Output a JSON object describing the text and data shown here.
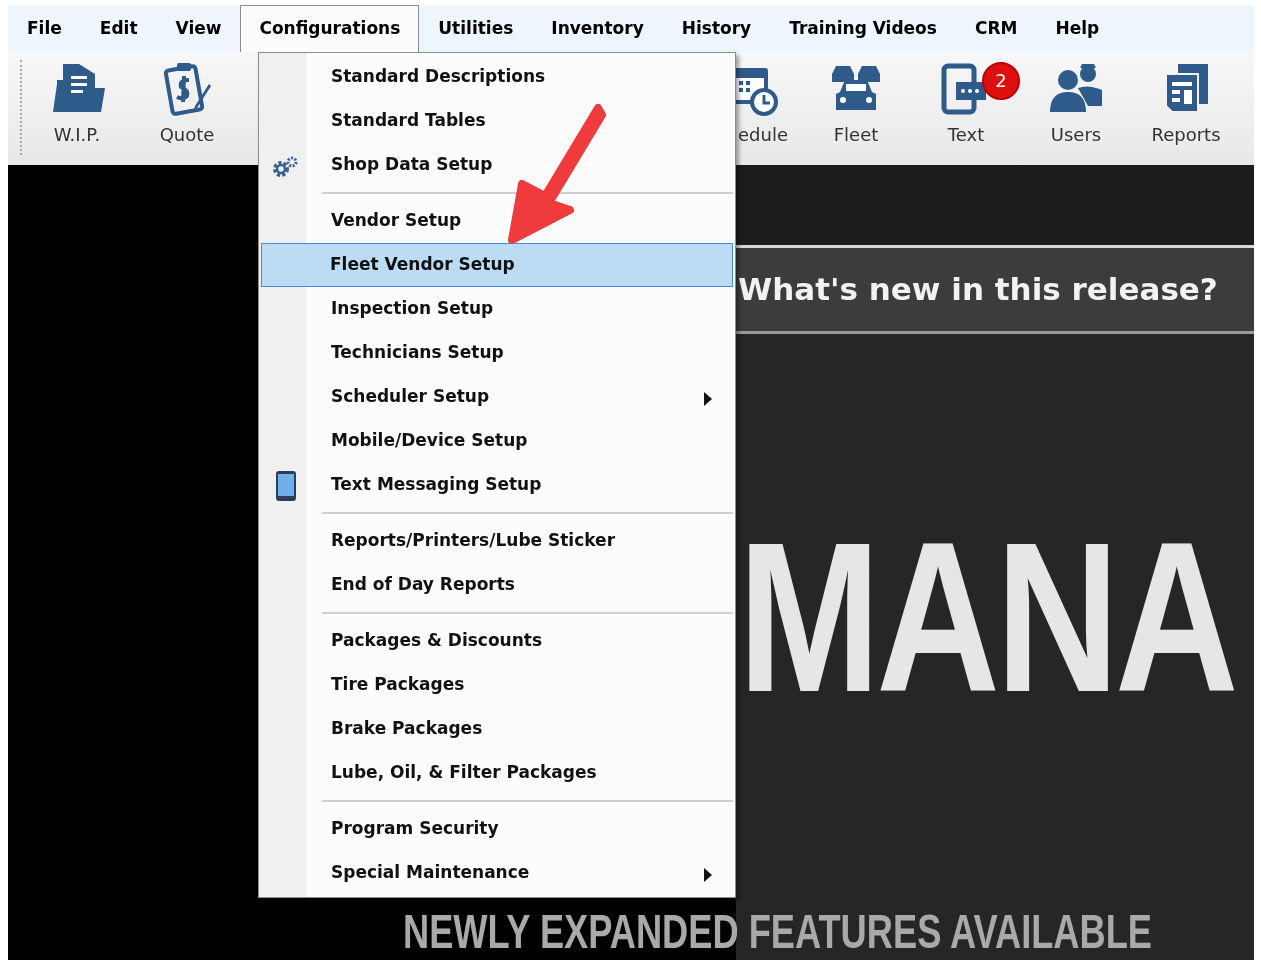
{
  "menu_bar": [
    {
      "label": "File",
      "selected": false
    },
    {
      "label": "Edit",
      "selected": false
    },
    {
      "label": "View",
      "selected": false
    },
    {
      "label": "Configurations",
      "selected": true
    },
    {
      "label": "Utilities",
      "selected": false
    },
    {
      "label": "Inventory",
      "selected": false
    },
    {
      "label": "History",
      "selected": false
    },
    {
      "label": "Training Videos",
      "selected": false
    },
    {
      "label": "CRM",
      "selected": false
    },
    {
      "label": "Help",
      "selected": false
    }
  ],
  "toolbar": {
    "left": [
      {
        "label": "W.I.P.",
        "kind": "folder",
        "partial": false
      },
      {
        "label": "Quote",
        "kind": "invoice",
        "partial": false
      }
    ],
    "right": [
      {
        "label": "edule",
        "kind": "calendar",
        "partial": true
      },
      {
        "label": "Fleet",
        "kind": "fleet",
        "partial": false
      },
      {
        "label": "Text",
        "kind": "text",
        "partial": false,
        "badge": "2"
      },
      {
        "label": "Users",
        "kind": "users",
        "partial": false
      },
      {
        "label": "Reports",
        "kind": "reports",
        "partial": false
      }
    ]
  },
  "dropdown": {
    "items": [
      {
        "kind": "item",
        "label": "Standard Descriptions",
        "selected": false,
        "submenu": false
      },
      {
        "kind": "item",
        "label": "Standard Tables",
        "selected": false,
        "submenu": false
      },
      {
        "kind": "gear_item",
        "label": "Shop Data Setup",
        "selected": false,
        "submenu": false
      },
      {
        "kind": "separator"
      },
      {
        "kind": "item",
        "label": "Vendor Setup",
        "selected": false,
        "submenu": false
      },
      {
        "kind": "item",
        "label": "Fleet Vendor Setup",
        "selected": true,
        "submenu": false
      },
      {
        "kind": "item",
        "label": "Inspection Setup",
        "selected": false,
        "submenu": false
      },
      {
        "kind": "item",
        "label": "Technicians Setup",
        "selected": false,
        "submenu": false
      },
      {
        "kind": "item",
        "label": "Scheduler Setup",
        "selected": false,
        "submenu": true
      },
      {
        "kind": "item",
        "label": "Mobile/Device Setup",
        "selected": false,
        "submenu": false
      },
      {
        "kind": "phone_item",
        "label": "Text Messaging Setup",
        "selected": false,
        "submenu": false
      },
      {
        "kind": "separator"
      },
      {
        "kind": "item",
        "label": "Reports/Printers/Lube Sticker",
        "selected": false,
        "submenu": false
      },
      {
        "kind": "item",
        "label": "End of Day Reports",
        "selected": false,
        "submenu": false
      },
      {
        "kind": "separator"
      },
      {
        "kind": "item",
        "label": "Packages & Discounts",
        "selected": false,
        "submenu": false
      },
      {
        "kind": "item",
        "label": "Tire Packages",
        "selected": false,
        "submenu": false
      },
      {
        "kind": "item",
        "label": "Brake Packages",
        "selected": false,
        "submenu": false
      },
      {
        "kind": "item",
        "label": "Lube, Oil, & Filter Packages",
        "selected": false,
        "submenu": false
      },
      {
        "kind": "separator"
      },
      {
        "kind": "item",
        "label": "Program Security",
        "selected": false,
        "submenu": false
      },
      {
        "kind": "item",
        "label": "Special Maintenance",
        "selected": false,
        "submenu": true
      }
    ]
  },
  "release_panel": {
    "heading": "What's new in this release?",
    "banner_text": "MANA",
    "tagline": "NEWLY EXPANDED FEATURES AVAILABLE"
  }
}
